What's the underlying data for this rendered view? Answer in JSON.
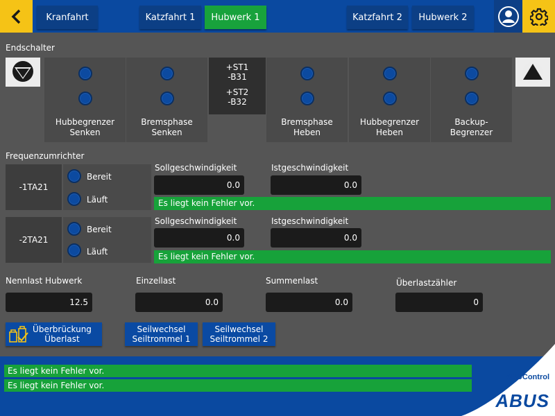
{
  "header": {
    "tabs": [
      {
        "label": "Kranfahrt",
        "active": false
      },
      {
        "label": "Katzfahrt 1",
        "active": false
      },
      {
        "label": "Hubwerk 1",
        "active": true
      },
      {
        "label": "Katzfahrt 2",
        "active": false
      },
      {
        "label": "Hubwerk 2",
        "active": false
      }
    ],
    "accent": "#f5c316",
    "bar_color": "#0a49a0",
    "active_tab_color": "#18a23c"
  },
  "endschalter": {
    "title": "Endschalter",
    "columns": [
      {
        "label_line1": "Hubbegrenzer",
        "label_line2": "Senken"
      },
      {
        "label_line1": "Bremsphase",
        "label_line2": "Senken"
      },
      {
        "label_line1": "Bremsphase",
        "label_line2": "Heben"
      },
      {
        "label_line1": "Hubbegrenzer",
        "label_line2": "Heben"
      },
      {
        "label_line1": "Backup-",
        "label_line2": "Begrenzer"
      }
    ],
    "st1_line1": "+ST1",
    "st1_line2": "-B31",
    "st2_line1": "+ST2",
    "st2_line2": "-B32",
    "down_icon": "arrow-down-icon",
    "up_icon": "arrow-up-icon"
  },
  "frequenzumrichter": {
    "title": "Frequenzumrichter",
    "units": [
      {
        "name": "-1TA21",
        "ready_label": "Bereit",
        "running_label": "Läuft",
        "setpoint_label": "Sollgeschwindigkeit",
        "setpoint_value": "0.0",
        "actual_label": "Istgeschwindigkeit",
        "actual_value": "0.0",
        "status": "Es liegt kein Fehler vor."
      },
      {
        "name": "-2TA21",
        "ready_label": "Bereit",
        "running_label": "Läuft",
        "setpoint_label": "Sollgeschwindigkeit",
        "setpoint_value": "0.0",
        "actual_label": "Istgeschwindigkeit",
        "actual_value": "0.0",
        "status": "Es liegt kein Fehler vor."
      }
    ]
  },
  "loads": {
    "nennlast_label": "Nennlast Hubwerk",
    "nennlast_value": "12.5",
    "einzellast_label": "Einzellast",
    "einzellast_value": "0.0",
    "summenlast_label": "Summenlast",
    "summenlast_value": "0.0",
    "ueberlast_label": "Überlastzähler",
    "ueberlast_value": "0"
  },
  "buttons": {
    "override_line1": "Überbrückung",
    "override_line2": "Überlast",
    "rope1_line1": "Seilwechsel",
    "rope1_line2": "Seiltrommel 1",
    "rope2_line1": "Seilwechsel",
    "rope2_line2": "Seiltrommel 2"
  },
  "footer": {
    "messages": [
      "Es liegt kein Fehler vor.",
      "Es liegt kein Fehler vor."
    ],
    "product": "ABUControl",
    "brand": "ABUS"
  }
}
